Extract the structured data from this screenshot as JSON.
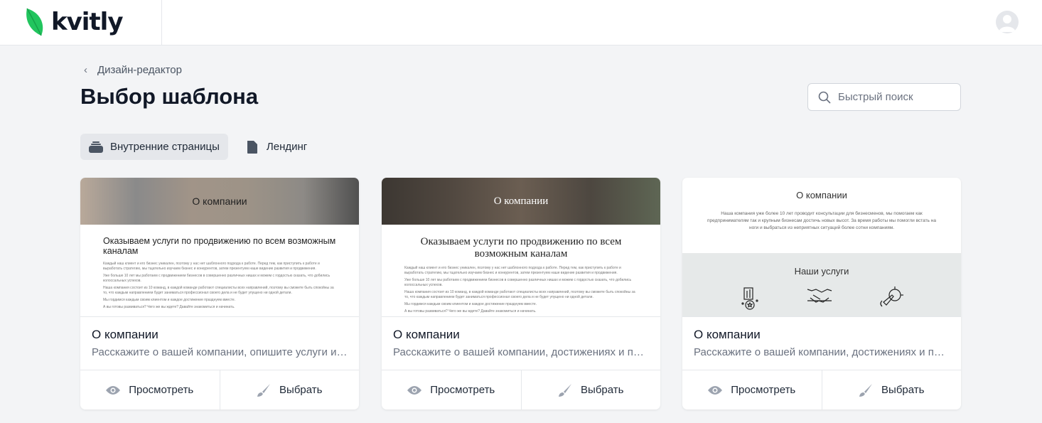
{
  "brand": {
    "name": "kvitly",
    "leaf_color": "#22c55e"
  },
  "breadcrumb": {
    "label": "Дизайн-редактор"
  },
  "page_title": "Выбор шаблона",
  "search": {
    "placeholder": "Быстрый поиск",
    "value": ""
  },
  "tabs": [
    {
      "label": "Внутренние страницы",
      "icon": "stack-icon",
      "active": true
    },
    {
      "label": "Лендинг",
      "icon": "file-icon",
      "active": false
    }
  ],
  "cards": [
    {
      "preview": {
        "header": "О компании",
        "heading": "Оказываем услуги по продвижению по всем возможным каналам",
        "paragraphs": [
          "Каждый наш клиент и его бизнес уникален, поэтому у нас нет шаблонного подхода к работе. Перед тем, как приступить к работе и выработать стратегию, мы тщательно изучаем бизнес и конкурентов, затем презентуем наше видение развития и продвижения.",
          "Уже больше 10 лет мы работаем с продвижением бизнесов в совершенно различных нишах и можем с гордостью сказать, что добились колоссальных успехов.",
          "Наша компания состоит из 10 команд, в каждой команде работают специалисты всех направлений, поэтому вы сможете быть спокойны за то, что каждым направлением будет заниматься профессионал своего дела и не будет упущено ни одной детали.",
          "Мы гордимся каждым своим клиентом и каждое достижение празднуем вместе.",
          "А вы готовы развиваться? Чего же вы ждете? Давайте знакомиться и начинать."
        ]
      },
      "name": "О компании",
      "description": "Расскажите о вашей компании, опишите услуги и преимущества",
      "view_label": "Просмотреть",
      "select_label": "Выбрать"
    },
    {
      "preview": {
        "header": "О компании",
        "heading": "Оказываем услуги по продвижению по всем возможным каналам",
        "paragraphs": [
          "Каждый наш клиент и его бизнес уникален, поэтому у нас нет шаблонного подхода к работе. Перед тем, как приступить к работе и выработать стратегию, мы тщательно изучаем бизнес и конкурентов, затем презентуем наше видение развития и продвижения.",
          "Уже больше 10 лет мы работаем с продвижением бизнесов в совершенно различных нишах и можем с гордостью сказать, что добились колоссальных успехов.",
          "Наша компания состоит из 10 команд, в каждой команде работают специалисты всех направлений, поэтому вы сможете быть спокойны за то, что каждым направлением будет заниматься профессионал своего дела и не будет упущено ни одной детали.",
          "Мы гордимся каждым своим клиентом и каждое достижение празднуем вместе.",
          "А вы готовы развиваться? Чего же вы ждете? Давайте знакомиться и начинать."
        ]
      },
      "name": "О компании",
      "description": "Расскажите о вашей компании, достижениях и преимуществах",
      "view_label": "Просмотреть",
      "select_label": "Выбрать"
    },
    {
      "preview": {
        "header": "О компании",
        "text": "Наша компания уже более 10 лет проводит консультации для бизнесменов, мы помогаем как предпринимателям так и крупным бизнесам достичь новых высот. За время работы мы помогли встать на ноги и выбраться из неприятных ситуаций более сотни компаниям.",
        "services_title": "Наши услуги",
        "service_icons": [
          "analytics-icon",
          "handshake-icon",
          "rocket-icon"
        ]
      },
      "name": "О компании",
      "description": "Расскажите о вашей компании, достижениях и преимуществах",
      "view_label": "Просмотреть",
      "select_label": "Выбрать"
    }
  ]
}
